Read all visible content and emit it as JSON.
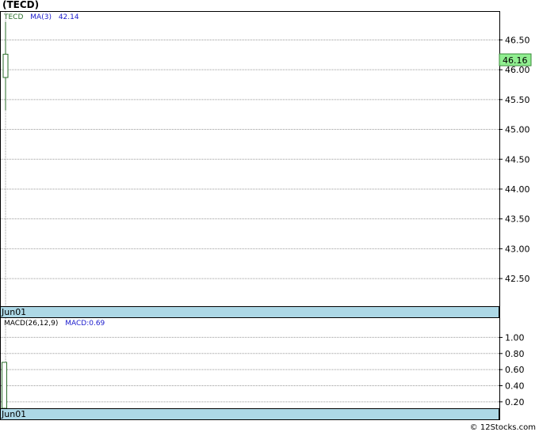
{
  "chart_title": "(TECD)",
  "price_panel": {
    "legend": {
      "symbol": "TECD",
      "ma_label": "MA(3)",
      "ma_value": "42.14"
    },
    "current_price_label": "46.16",
    "date_label": "Jun01"
  },
  "macd_panel": {
    "legend": {
      "label": "MACD(26,12,9)",
      "value_label": "MACD:0.69"
    },
    "date_label": "Jun01"
  },
  "footer": "© 12Stocks.com",
  "colors": {
    "candle": "#2a6e2a",
    "grid": "#9a9a9a",
    "date_band": "#add8e6",
    "price_tag": "#90ee90",
    "ma_text": "#1a1acc",
    "symbol_text": "#2a6e2a"
  },
  "chart_data": [
    {
      "type": "candlestick",
      "title": "(TECD)",
      "x": [
        "Jun01"
      ],
      "ohlc": [
        {
          "date": "Jun01",
          "open": 45.87,
          "high": 46.8,
          "low": 45.32,
          "close": 46.26
        }
      ],
      "current_price": 46.16,
      "y_ticks": [
        "46.50",
        "46.00",
        "45.50",
        "45.00",
        "44.50",
        "44.00",
        "43.50",
        "43.00",
        "42.50"
      ],
      "ylim": [
        42.05,
        46.97
      ],
      "grid": true
    },
    {
      "type": "bar",
      "title": "MACD(26,12,9)",
      "x": [
        "Jun01"
      ],
      "values": [
        0.69
      ],
      "y_ticks": [
        "1.00",
        "0.80",
        "0.60",
        "0.40",
        "0.20"
      ],
      "ylim": [
        0.12,
        1.24
      ],
      "grid": true
    }
  ]
}
